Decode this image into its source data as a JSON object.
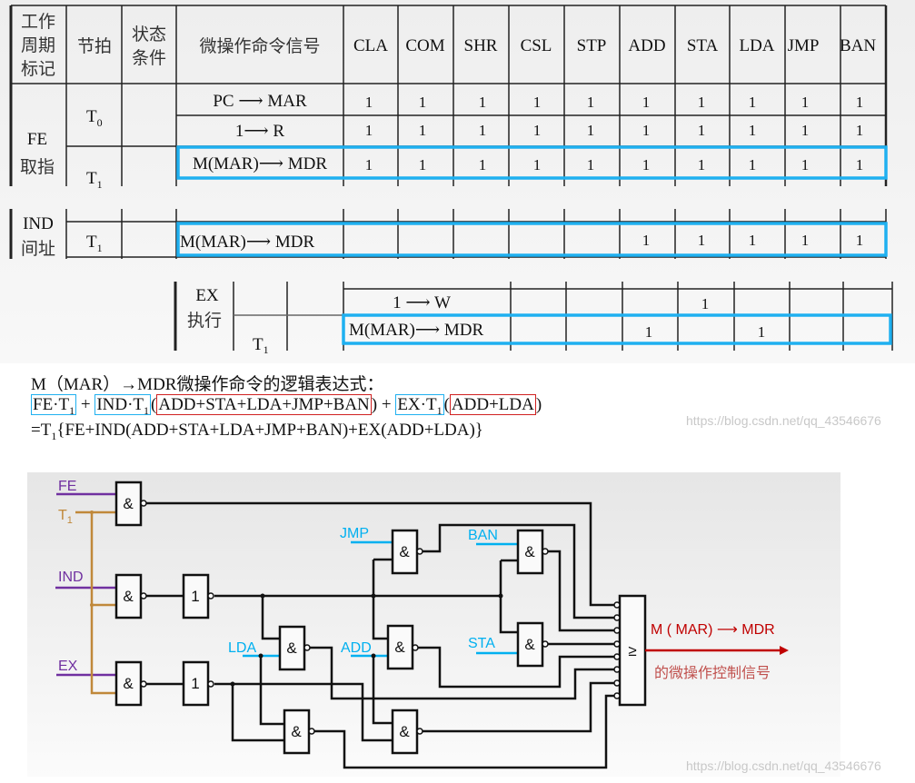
{
  "table": {
    "header": {
      "cycle": [
        "工作",
        "周期",
        "标记"
      ],
      "beat": "节拍",
      "condition": [
        "状态",
        "条件"
      ],
      "signal": "微操作命令信号",
      "instructions": [
        "CLA",
        "COM",
        "SHR",
        "CSL",
        "STP",
        "ADD",
        "STA",
        "LDA",
        "JMP",
        "BAN"
      ]
    },
    "fe": {
      "cycle": "FE",
      "cycle_cn": "取指",
      "t0": "T",
      "t0_sub": "0",
      "t1": "T",
      "t1_sub": "1",
      "rows": [
        {
          "op": "PC ⟶ MAR",
          "values": [
            "1",
            "1",
            "1",
            "1",
            "1",
            "1",
            "1",
            "1",
            "1",
            "1"
          ]
        },
        {
          "op": "1⟶ R",
          "values": [
            "1",
            "1",
            "1",
            "1",
            "1",
            "1",
            "1",
            "1",
            "1",
            "1"
          ]
        },
        {
          "op": "M(MAR)⟶ MDR",
          "values": [
            "1",
            "1",
            "1",
            "1",
            "1",
            "1",
            "1",
            "1",
            "1",
            "1"
          ]
        }
      ]
    },
    "ind": {
      "cycle": "IND",
      "cycle_cn": "间址",
      "t1": "T",
      "t1_sub": "1",
      "row": {
        "op": "M(MAR)⟶ MDR",
        "values": [
          "",
          "",
          "",
          "",
          "",
          "1",
          "1",
          "1",
          "1",
          "1"
        ]
      }
    },
    "ex": {
      "cycle": "EX",
      "cycle_cn": "执行",
      "t1": "T",
      "t1_sub": "1",
      "rows": [
        {
          "op": "1 ⟶ W",
          "values": [
            "",
            "",
            "",
            "1",
            "",
            "",
            ""
          ]
        },
        {
          "op": "M(MAR)⟶ MDR",
          "values": [
            "",
            "",
            "1",
            "",
            "1",
            "",
            ""
          ]
        }
      ]
    },
    "highlight_color": "#1fb0f0"
  },
  "formula": {
    "title": "M（MAR）→MDR微操作命令的逻辑表达式：",
    "line2": {
      "a": "FE·T",
      "a_sub": "1",
      "plus1": " + ",
      "b": "IND·T",
      "b_sub": "1",
      "open1": "(",
      "c": "ADD+STA+LDA+JMP+BAN",
      "close1": ") + ",
      "d": "EX·T",
      "d_sub": "1",
      "open2": "(",
      "e": "ADD+LDA",
      "close2": ")"
    },
    "line3": {
      "pre": "=T",
      "sub": "1",
      "rest": "{FE+IND(ADD+STA+LDA+JMP+BAN)+EX(ADD+LDA)}"
    },
    "box_colors": {
      "term": "#1fb0f0",
      "group": "#d02020"
    }
  },
  "circuit": {
    "inputs": {
      "fe": "FE",
      "t1": "T",
      "t1_sub": "1",
      "ind": "IND",
      "ex": "EX"
    },
    "ops": {
      "jmp": "JMP",
      "ban": "BAN",
      "lda": "LDA",
      "add": "ADD",
      "sta": "STA"
    },
    "and_symbol": "&",
    "not_symbol": "1",
    "or_symbol": "≥",
    "output_label": "M ( MAR)  ⟶  MDR",
    "output_caption": "的微操作控制信号",
    "colors": {
      "cycle": "#7030a0",
      "clock": "#c0883a",
      "op": "#00b0f0",
      "output": "#c00000"
    }
  },
  "watermark": "https://blog.csdn.net/qq_43546676"
}
